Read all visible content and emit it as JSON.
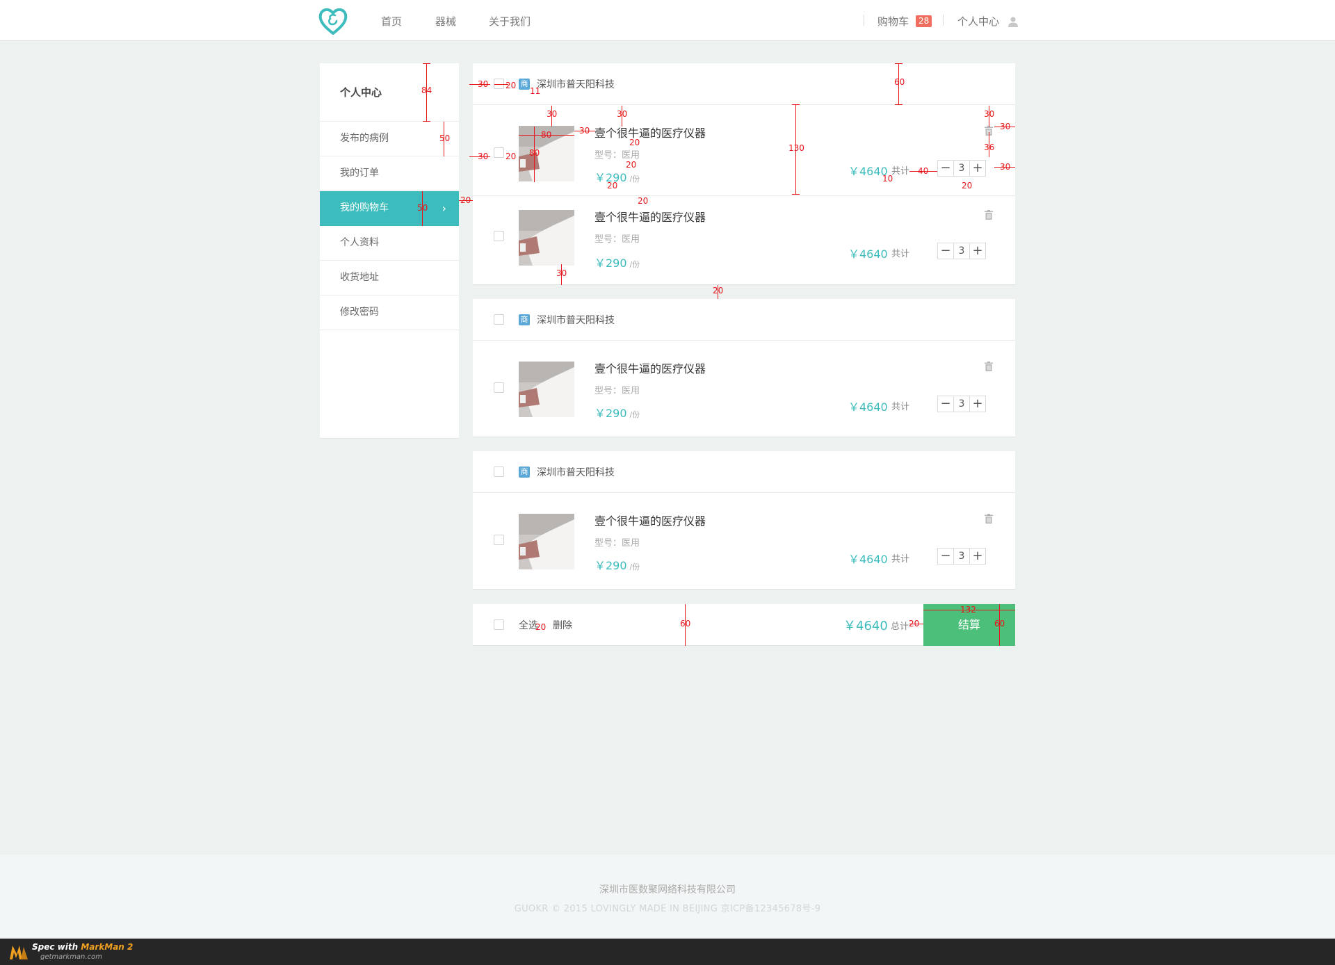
{
  "header": {
    "nav": [
      "首页",
      "器械",
      "关于我们"
    ],
    "cart_label": "购物车",
    "cart_count": "28",
    "user_label": "个人中心"
  },
  "sidebar": {
    "title": "个人中心",
    "items": [
      {
        "label": "发布的病例",
        "active": false
      },
      {
        "label": "我的订单",
        "active": false
      },
      {
        "label": "我的购物车",
        "active": true
      },
      {
        "label": "个人资料",
        "active": false
      },
      {
        "label": "收货地址",
        "active": false
      },
      {
        "label": "修改密码",
        "active": false
      }
    ]
  },
  "shop_icon": "商",
  "shops": [
    {
      "name": "深圳市普天阳科技",
      "items": [
        {
          "name": "壹个很牛逼的医疗仪器",
          "model_label": "型号：",
          "model": "医用",
          "price": "￥290",
          "unit": "/份",
          "total": "￥4640",
          "total_label": "共计",
          "qty": "3"
        },
        {
          "name": "壹个很牛逼的医疗仪器",
          "model_label": "型号：",
          "model": "医用",
          "price": "￥290",
          "unit": "/份",
          "total": "￥4640",
          "total_label": "共计",
          "qty": "3"
        }
      ]
    },
    {
      "name": "深圳市普天阳科技",
      "items": [
        {
          "name": "壹个很牛逼的医疗仪器",
          "model_label": "型号：",
          "model": "医用",
          "price": "￥290",
          "unit": "/份",
          "total": "￥4640",
          "total_label": "共计",
          "qty": "3"
        }
      ]
    },
    {
      "name": "深圳市普天阳科技",
      "items": [
        {
          "name": "壹个很牛逼的医疗仪器",
          "model_label": "型号：",
          "model": "医用",
          "price": "￥290",
          "unit": "/份",
          "total": "￥4640",
          "total_label": "共计",
          "qty": "3"
        }
      ]
    }
  ],
  "summary": {
    "select_all": "全选",
    "delete": "删除",
    "total": "￥4640",
    "total_label": "总计",
    "checkout": "结算"
  },
  "footer": {
    "company": "深圳市医数聚网络科技有限公司",
    "copyright": "GUOKR © 2015 LOVINGLY MADE IN BEIJING 京ICP备12345678号-9"
  },
  "markman": {
    "spec_with": "Spec with",
    "brand": "MarkMan 2",
    "site": "getmarkman.com"
  },
  "annotations": [
    "84",
    "50",
    "30",
    "20",
    "11",
    "60",
    "30",
    "30",
    "30",
    "30",
    "80",
    "80",
    "30",
    "20",
    "20",
    "20",
    "20",
    "20",
    "36",
    "30",
    "10",
    "40",
    "20",
    "130",
    "20",
    "30",
    "20",
    "50",
    "60",
    "132",
    "20",
    "60"
  ],
  "colors": {
    "accent": "#3cbcbc",
    "checkout": "#4cc07a",
    "badge": "#f06e5f",
    "annotation": "#e8161a"
  }
}
